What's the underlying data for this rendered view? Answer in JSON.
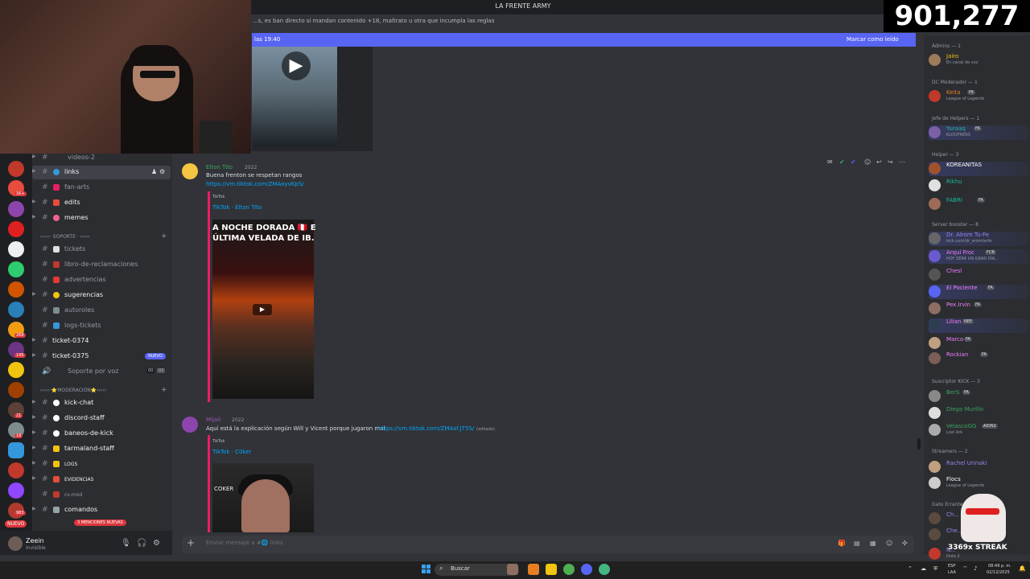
{
  "server": {
    "title": "LA FRENTE ARMY"
  },
  "stream": {
    "viewers": "901,277",
    "streak": "3369x STREAK"
  },
  "channel": {
    "topic": "...s, es ban directo si mandan contenido +18, maltrato u otra que incumpla las reglas",
    "pin_time": "las 19:40",
    "mark_read": "Marcar como leído"
  },
  "channels": [
    {
      "name": "videos-2",
      "bright": false
    },
    {
      "name": "links",
      "bright": true,
      "active": true
    },
    {
      "name": "fan-arts",
      "bright": false
    },
    {
      "name": "edits",
      "bright": true
    },
    {
      "name": "memes",
      "bright": true
    },
    {
      "name": "tickets",
      "bright": false
    },
    {
      "name": "libro-de-reclamaciones",
      "bright": false
    },
    {
      "name": "advertencias",
      "bright": false
    },
    {
      "name": "sugerencias",
      "bright": true
    },
    {
      "name": "autoroles",
      "bright": false
    },
    {
      "name": "logs-tickets",
      "bright": false
    },
    {
      "name": "ticket-0374",
      "bright": true
    },
    {
      "name": "ticket-0375",
      "bright": true
    },
    {
      "name": "Soporte por voz",
      "bright": false
    },
    {
      "name": "kick-chat",
      "bright": true
    },
    {
      "name": "discord-staff",
      "bright": true
    },
    {
      "name": "baneos-de-kick",
      "bright": true
    },
    {
      "name": "tarmaland-staff",
      "bright": true
    },
    {
      "name": "LOGS",
      "bright": true
    },
    {
      "name": "EVIDENCIAS",
      "bright": true
    },
    {
      "name": "cv-mod",
      "bright": false
    },
    {
      "name": "comandos",
      "bright": true
    }
  ],
  "categories": {
    "soporte": "›››››· SOPORTE · ‹‹‹‹‹",
    "moderacion": "›››››·⭐MODERACIÓN⭐‹‹‹‹‹"
  },
  "badges": {
    "nuevo_channel": "NUEVO",
    "nuevo_rail": "NUEVO",
    "mentions": "3 MENCIONES NUEVAS",
    "voice_count_a": "00",
    "voice_count_b": "03"
  },
  "rail_badges": [
    "1K+",
    "268",
    "145",
    "21",
    "16",
    "983"
  ],
  "user": {
    "name": "Zeein",
    "status": "Invisible"
  },
  "messages": [
    {
      "author": "Elton Tito",
      "author_color": "#3ba55c",
      "date": "2022",
      "text": "Buena frenton se respetan rangos",
      "link": "https://vm.tiktok.com/ZMAoyvKpS/",
      "embed_site": "TikTok",
      "embed_title": "TikTok · Elton Tito",
      "caption1": "A NOCHE DORADA 🇵🇪 E",
      "caption2": "ÚLTIMA VELADA DE IB."
    },
    {
      "author": "Mijail",
      "author_color": "#9b59b6",
      "date": "2022",
      "text": "Aquí está la explicación según Will y Vicent porque jugaron mal",
      "link": "https://vm.tiktok.com/ZMAof.JT5S/",
      "edited": "(editado)",
      "embed_site": "TikTok",
      "embed_title": "TikTok · C0ker",
      "caption": "COKER"
    }
  ],
  "composer": {
    "placeholder": "Enviar mensaje a #🌐 links"
  },
  "member_groups": [
    {
      "label": "Admins — 1"
    },
    {
      "label": "DC Moderador — 1"
    },
    {
      "label": "Jefe de Helpers — 1"
    },
    {
      "label": "Helper — 3"
    },
    {
      "label": "Server booster — 8"
    },
    {
      "label": "Suscriptor KICK — 3"
    },
    {
      "label": "Streamers — 2"
    },
    {
      "label": "Gato Errante"
    }
  ],
  "members": [
    {
      "name": "Jairo",
      "color": "#f1c40f",
      "activity": "En canal de voz",
      "tag": ""
    },
    {
      "name": "Keita",
      "color": "#e67e22",
      "activity": "League of Legends",
      "tag": "FA"
    },
    {
      "name": "Yuraaq",
      "color": "#1abc9c",
      "activity": "KLOUFRENS",
      "tag": "FA"
    },
    {
      "name": "KOREANITAS",
      "color": "#ffffff",
      "activity": "",
      "tag": ""
    },
    {
      "name": "Rikhu",
      "color": "#1abc9c",
      "activity": "",
      "tag": ""
    },
    {
      "name": "FABRI",
      "color": "#1abc9c",
      "activity": "",
      "tag": "FA"
    },
    {
      "name": "Dr. Alrom Tu-Fe",
      "color": "#9b84ee",
      "activity": "kick.com/dr_aromtarfe",
      "tag": ""
    },
    {
      "name": "Arqui Froc",
      "color": "#f47fff",
      "activity": "HOY SERÁ UN GRAN DÍA...",
      "tag": "FCB"
    },
    {
      "name": "Chesl",
      "color": "#f47fff",
      "activity": "",
      "tag": ""
    },
    {
      "name": "El Pociente",
      "color": "#f47fff",
      "activity": "",
      "tag": "FA"
    },
    {
      "name": "Pex.Irvin",
      "color": "#f47fff",
      "activity": "",
      "tag": "FA"
    },
    {
      "name": "Lilian",
      "color": "#f47fff",
      "activity": "",
      "tag": "NEE"
    },
    {
      "name": "Marco",
      "color": "#f47fff",
      "activity": "",
      "tag": "FA"
    },
    {
      "name": "Rockian",
      "color": "#f47fff",
      "activity": "",
      "tag": "FA"
    },
    {
      "name": "BerS",
      "color": "#3ba55c",
      "activity": "",
      "tag": "FA"
    },
    {
      "name": "Diego Murillo",
      "color": "#3ba55c",
      "activity": "",
      "tag": ""
    },
    {
      "name": "VelascoGG",
      "color": "#3ba55c",
      "activity": "Lost Ark",
      "tag": "AION2"
    },
    {
      "name": "Rachel Urinaki",
      "color": "#9b84ee",
      "activity": "",
      "tag": ""
    },
    {
      "name": "Flocs",
      "color": "#ffffff",
      "activity": "League of Legends",
      "tag": ""
    },
    {
      "name": "Ch...",
      "color": "#9b84ee",
      "activity": "",
      "tag": ""
    },
    {
      "name": "Che...",
      "color": "#9b84ee",
      "activity": "",
      "tag": ""
    },
    {
      "name": "N...",
      "color": "#9b84ee",
      "activity": "Dota 2",
      "tag": ""
    }
  ],
  "taskbar": {
    "search": "Buscar",
    "lang1": "ESP",
    "lang2": "LAA",
    "time": "08:49 p. m.",
    "date": "02/12/2025"
  },
  "colors": {
    "accent": "#5865f2",
    "danger": "#da373c",
    "link": "#00a8fc",
    "bg": "#313338"
  }
}
